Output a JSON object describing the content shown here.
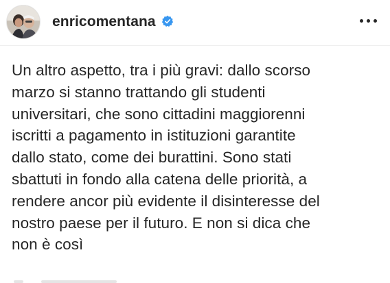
{
  "post": {
    "username": "enricomentana",
    "verified": true,
    "avatar": "avatar-photo",
    "more_icon": "more-horizontal-icon",
    "lines": [
      "Un altro aspetto, tra i più gravi: dallo scorso",
      "marzo si stanno trattando gli studenti",
      "universitari, che sono cittadini maggiorenni",
      "iscritti a pagamento in istituzioni garantite",
      "dallo stato, come dei burattini. Sono stati",
      "sbattuti in fondo alla catena delle priorità, a",
      "rendere ancor più evidente il disinteresse del",
      "nostro paese per il futuro. E non si dica che",
      "non è così"
    ]
  },
  "colors": {
    "text": "#262626",
    "verified_blue": "#3897f0",
    "divider": "#efefef",
    "background": "#ffffff"
  }
}
